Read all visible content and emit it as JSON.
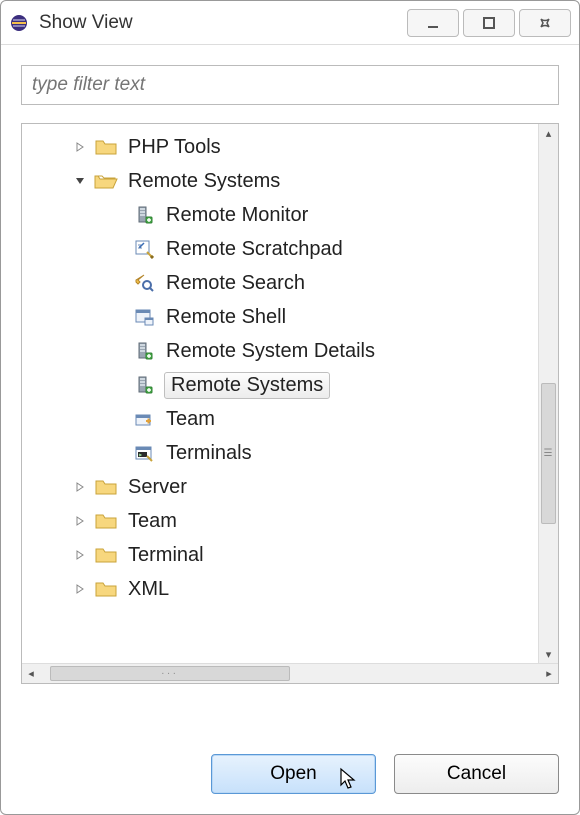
{
  "window": {
    "title": "Show View"
  },
  "filter": {
    "placeholder": "type filter text",
    "value": ""
  },
  "tree": {
    "nodes": [
      {
        "label": "PHP Tools",
        "level": 1,
        "expanded": false,
        "icon": "folder",
        "selected": false,
        "hasChildren": true
      },
      {
        "label": "Remote Systems",
        "level": 1,
        "expanded": true,
        "icon": "folder-open",
        "selected": false,
        "hasChildren": true
      },
      {
        "label": "Remote Monitor",
        "level": 2,
        "expanded": null,
        "icon": "server",
        "selected": false,
        "hasChildren": false
      },
      {
        "label": "Remote Scratchpad",
        "level": 2,
        "expanded": null,
        "icon": "scratchpad",
        "selected": false,
        "hasChildren": false
      },
      {
        "label": "Remote Search",
        "level": 2,
        "expanded": null,
        "icon": "search",
        "selected": false,
        "hasChildren": false
      },
      {
        "label": "Remote Shell",
        "level": 2,
        "expanded": null,
        "icon": "shell",
        "selected": false,
        "hasChildren": false
      },
      {
        "label": "Remote System Details",
        "level": 2,
        "expanded": null,
        "icon": "server",
        "selected": false,
        "hasChildren": false
      },
      {
        "label": "Remote Systems",
        "level": 2,
        "expanded": null,
        "icon": "server",
        "selected": true,
        "hasChildren": false
      },
      {
        "label": "Team",
        "level": 2,
        "expanded": null,
        "icon": "team",
        "selected": false,
        "hasChildren": false
      },
      {
        "label": "Terminals",
        "level": 2,
        "expanded": null,
        "icon": "terminal",
        "selected": false,
        "hasChildren": false
      },
      {
        "label": "Server",
        "level": 1,
        "expanded": false,
        "icon": "folder",
        "selected": false,
        "hasChildren": true
      },
      {
        "label": "Team",
        "level": 1,
        "expanded": false,
        "icon": "folder",
        "selected": false,
        "hasChildren": true
      },
      {
        "label": "Terminal",
        "level": 1,
        "expanded": false,
        "icon": "folder",
        "selected": false,
        "hasChildren": true
      },
      {
        "label": "XML",
        "level": 1,
        "expanded": false,
        "icon": "folder",
        "selected": false,
        "hasChildren": true
      }
    ]
  },
  "buttons": {
    "open": "Open",
    "cancel": "Cancel"
  }
}
